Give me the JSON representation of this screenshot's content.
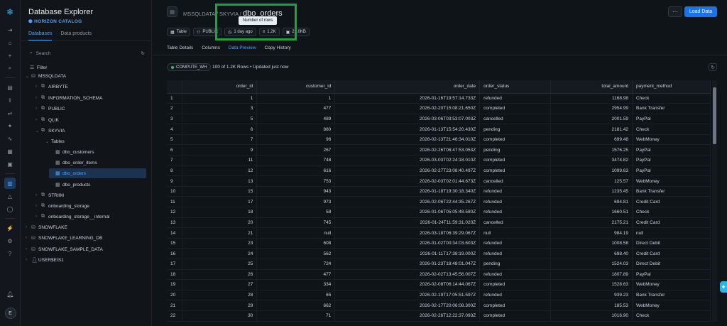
{
  "sidebar": {
    "title": "Database Explorer",
    "subtitle": "HORIZON CATALOG",
    "tabs": [
      "Databases",
      "Data products"
    ],
    "search_placeholder": "Search",
    "filter_label": "Filter",
    "tree": [
      {
        "label": "MSSQLDATA",
        "level": 0,
        "icon": "database-icon",
        "expanded": true
      },
      {
        "label": "AIRBYTE",
        "level": 1,
        "icon": "schema-icon"
      },
      {
        "label": "INFORMATION_SCHEMA",
        "level": 1,
        "icon": "schema-icon"
      },
      {
        "label": "PUBLIC",
        "level": 1,
        "icon": "schema-icon"
      },
      {
        "label": "QLIK",
        "level": 1,
        "icon": "schema-icon"
      },
      {
        "label": "SKYVIA",
        "level": 1,
        "icon": "schema-icon",
        "expanded": true
      },
      {
        "label": "Tables",
        "level": 2,
        "icon": "folder-icon",
        "expanded": true
      },
      {
        "label": "dbo_customers",
        "level": 3,
        "icon": "table-icon"
      },
      {
        "label": "dbo_order_items",
        "level": 3,
        "icon": "table-icon"
      },
      {
        "label": "dbo_orders",
        "level": 3,
        "icon": "table-icon",
        "selected": true
      },
      {
        "label": "dbo_products",
        "level": 3,
        "icon": "table-icon"
      },
      {
        "label": "STRIIM",
        "level": 1,
        "icon": "schema-icon"
      },
      {
        "label": "onboarding_storage",
        "level": 1,
        "icon": "schema-icon"
      },
      {
        "label": "onboarding_storage__internal",
        "level": 1,
        "icon": "schema-icon"
      },
      {
        "label": "SNOWFLAKE",
        "level": 0,
        "icon": "database-icon"
      },
      {
        "label": "SNOWFLAKE_LEARNING_DB",
        "level": 0,
        "icon": "database-icon"
      },
      {
        "label": "SNOWFLAKE_SAMPLE_DATA",
        "level": 0,
        "icon": "database-icon"
      },
      {
        "label": "USER$EIS1",
        "level": 0,
        "icon": "user-icon"
      }
    ]
  },
  "header": {
    "database": "MSSQLDATA",
    "schema": "SKYVIA",
    "table": "dbo_orders",
    "tooltip": "Number of rows",
    "chips": {
      "type": "Table",
      "schema": "PUBLIC",
      "updated": "1 day ago",
      "rows": "1.2K",
      "size": "21.0KB"
    },
    "more_label": "···",
    "load_label": "Load Data"
  },
  "tabs": [
    "Table Details",
    "Columns",
    "Data Preview",
    "Copy History"
  ],
  "toolbar": {
    "warehouse": "COMPUTE_WH",
    "info": "100 of 1.2K Rows • Updated just now"
  },
  "table": {
    "columns": [
      "",
      "order_id",
      "customer_id",
      "order_date",
      "order_status",
      "total_amount",
      "payment_method"
    ],
    "rows": [
      [
        "1",
        "1",
        "1",
        "2026-01-16T19:57:14.733Z",
        "refunded",
        "1168.98",
        "Check"
      ],
      [
        "2",
        "3",
        "477",
        "2026-02-20T15:08:21.650Z",
        "completed",
        "2954.99",
        "Bank Transfer"
      ],
      [
        "3",
        "5",
        "489",
        "2026-03-06T03:53:07.003Z",
        "cancelled",
        "2001.59",
        "PayPal"
      ],
      [
        "4",
        "6",
        "880",
        "2026-01-13T15:54:20.430Z",
        "pending",
        "2181.42",
        "Check"
      ],
      [
        "5",
        "7",
        "96",
        "2026-02-13T21:46:34.010Z",
        "completed",
        "699.48",
        "WebMoney"
      ],
      [
        "6",
        "9",
        "267",
        "2026-02-26T06:47:53.053Z",
        "pending",
        "1576.25",
        "PayPal"
      ],
      [
        "7",
        "11",
        "748",
        "2026-03-03T02:24:18.010Z",
        "completed",
        "3474.82",
        "PayPal"
      ],
      [
        "8",
        "12",
        "616",
        "2026-02-27T23:08:40.497Z",
        "completed",
        "1099.63",
        "PayPal"
      ],
      [
        "9",
        "13",
        "753",
        "2026-02-03T02:01:44.673Z",
        "cancelled",
        "125.57",
        "WebMoney"
      ],
      [
        "10",
        "15",
        "943",
        "2026-01-18T19:30:18.340Z",
        "refunded",
        "1235.45",
        "Bank Transfer"
      ],
      [
        "11",
        "17",
        "973",
        "2026-02-06T22:44:35.267Z",
        "refunded",
        "694.81",
        "Credit Card"
      ],
      [
        "12",
        "18",
        "58",
        "2026-01-06T05:05:48.580Z",
        "refunded",
        "1660.51",
        "Check"
      ],
      [
        "13",
        "20",
        "745",
        "2026-01-24T11:59:31.020Z",
        "cancelled",
        "2175.21",
        "Credit Card"
      ],
      [
        "14",
        "21",
        "null",
        "2026-03-18T06:39:29.067Z",
        "null",
        "984.19",
        "null"
      ],
      [
        "15",
        "23",
        "608",
        "2026-01-02T00:34:03.603Z",
        "refunded",
        "1008.58",
        "Direct Debit"
      ],
      [
        "16",
        "24",
        "562",
        "2026-01-11T17:38:19.000Z",
        "refunded",
        "698.40",
        "Credit Card"
      ],
      [
        "17",
        "25",
        "724",
        "2026-01-23T18:48:01.047Z",
        "pending",
        "1524.03",
        "Direct Debit"
      ],
      [
        "18",
        "26",
        "477",
        "2026-02-02T13:45:56.007Z",
        "refunded",
        "1807.89",
        "PayPal"
      ],
      [
        "19",
        "27",
        "334",
        "2026-02-08T06:14:44.067Z",
        "completed",
        "1528.63",
        "WebMoney"
      ],
      [
        "20",
        "28",
        "65",
        "2026-02-19T17:05:51.597Z",
        "refunded",
        "939.23",
        "Bank Transfer"
      ],
      [
        "21",
        "29",
        "662",
        "2026-02-17T20:06:08.300Z",
        "completed",
        "185.53",
        "WebMoney"
      ],
      [
        "22",
        "30",
        "71",
        "2026-02-26T12:22:37.093Z",
        "completed",
        "1016.90",
        "Check"
      ]
    ]
  },
  "rail": {
    "avatar": "E"
  }
}
